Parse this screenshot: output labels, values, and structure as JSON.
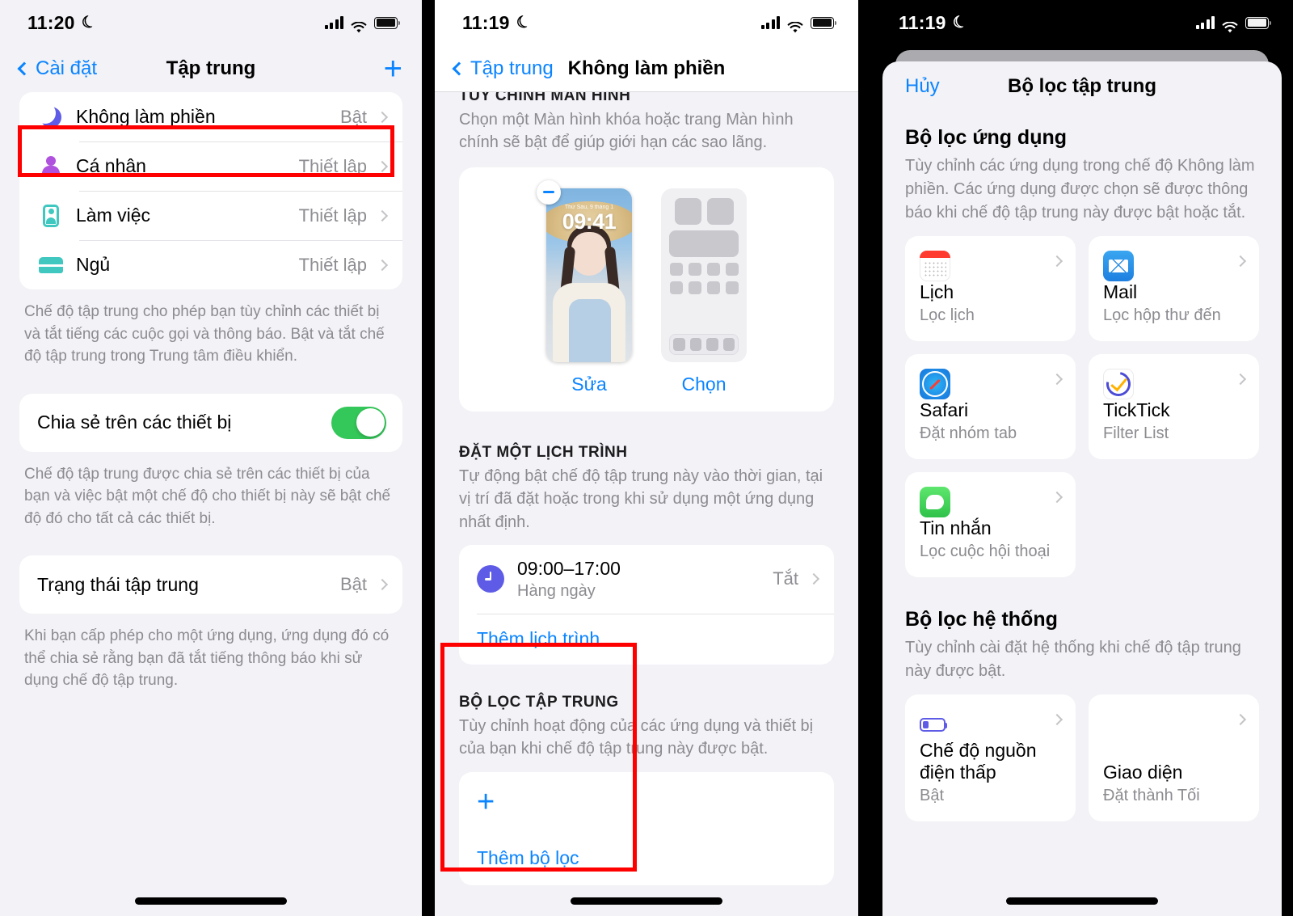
{
  "panel1": {
    "status": {
      "time": "11:20",
      "moon_icon": "moon-icon"
    },
    "nav": {
      "back_label": "Cài đặt",
      "title": "Tập trung",
      "add_icon": "plus-icon"
    },
    "focus_list": [
      {
        "icon": "moon-icon",
        "label": "Không làm phiền",
        "value": "Bật"
      },
      {
        "icon": "person-icon",
        "label": "Cá nhân",
        "value": "Thiết lập"
      },
      {
        "icon": "work-badge-icon",
        "label": "Làm việc",
        "value": "Thiết lập"
      },
      {
        "icon": "bed-icon",
        "label": "Ngủ",
        "value": "Thiết lập"
      }
    ],
    "focus_footer": "Chế độ tập trung cho phép bạn tùy chỉnh các thiết bị và tắt tiếng các cuộc gọi và thông báo. Bật và tắt chế độ tập trung trong Trung tâm điều khiển.",
    "share_row": {
      "label": "Chia sẻ trên các thiết bị",
      "toggle_on": true
    },
    "share_footer": "Chế độ tập trung được chia sẻ trên các thiết bị của bạn và việc bật một chế độ cho thiết bị này sẽ bật chế độ đó cho tất cả các thiết bị.",
    "status_row": {
      "label": "Trạng thái tập trung",
      "value": "Bật"
    },
    "status_footer": "Khi bạn cấp phép cho một ứng dụng, ứng dụng đó có thể chia sẻ rằng bạn đã tắt tiếng thông báo khi sử dụng chế độ tập trung."
  },
  "panel2": {
    "status": {
      "time": "11:19",
      "moon_icon": "moon-icon"
    },
    "nav": {
      "back_label": "Tập trung",
      "title": "Không làm phiền"
    },
    "screen_section": {
      "header": "TÙY CHỈNH MÀN HÌNH",
      "sub": "Chọn một Màn hình khóa hoặc trang Màn hình chính sẽ bật để giúp giới hạn các sao lãng.",
      "lock_date": "Thứ Sáu, 9 tháng 1",
      "lock_time": "09:41",
      "edit_label": "Sửa",
      "choose_label": "Chọn"
    },
    "schedule_section": {
      "header": "ĐẶT MỘT LỊCH TRÌNH",
      "sub": "Tự động bật chế độ tập trung này vào thời gian, tại vị trí đã đặt hoặc trong khi sử dụng một ứng dụng nhất định.",
      "row_title": "09:00–17:00",
      "row_sub": "Hàng ngày",
      "row_value": "Tắt",
      "add_label": "Thêm lịch trình"
    },
    "filter_section": {
      "header": "BỘ LỌC TẬP TRUNG",
      "sub": "Tùy chỉnh hoạt động của các ứng dụng và thiết bị của bạn khi chế độ tập trung này được bật.",
      "plus_icon": "plus-icon",
      "add_label": "Thêm bộ lọc"
    }
  },
  "panel3": {
    "status": {
      "time": "11:19",
      "moon_icon": "moon-icon"
    },
    "sheet": {
      "cancel_label": "Hủy",
      "title": "Bộ lọc tập trung"
    },
    "app_group": {
      "title": "Bộ lọc ứng dụng",
      "sub": "Tùy chỉnh các ứng dụng trong chế độ Không làm phiền. Các ứng dụng được chọn sẽ được thông báo khi chế độ tập trung này được bật hoặc tắt.",
      "tiles": [
        {
          "icon": "calendar-app-icon",
          "name": "Lịch",
          "sub": "Lọc lịch"
        },
        {
          "icon": "mail-app-icon",
          "name": "Mail",
          "sub": "Lọc hộp thư đến"
        },
        {
          "icon": "safari-app-icon",
          "name": "Safari",
          "sub": "Đặt nhóm tab"
        },
        {
          "icon": "ticktick-app-icon",
          "name": "TickTick",
          "sub": "Filter List"
        },
        {
          "icon": "messages-app-icon",
          "name": "Tin nhắn",
          "sub": "Lọc cuộc hội thoại"
        }
      ]
    },
    "system_group": {
      "title": "Bộ lọc hệ thống",
      "sub": "Tùy chỉnh cài đặt hệ thống khi chế độ tập trung này được bật.",
      "tiles": [
        {
          "icon": "low-power-icon",
          "name": "Chế độ nguồn điện thấp",
          "sub": "Bật"
        },
        {
          "icon": "appearance-icon",
          "name": "Giao diện",
          "sub": "Đặt thành Tối"
        }
      ]
    }
  },
  "colors": {
    "accent_blue": "#0a84ff",
    "toggle_green": "#34c759",
    "focus_purple": "#5e5ce6",
    "annotation_red": "#ff0000"
  }
}
